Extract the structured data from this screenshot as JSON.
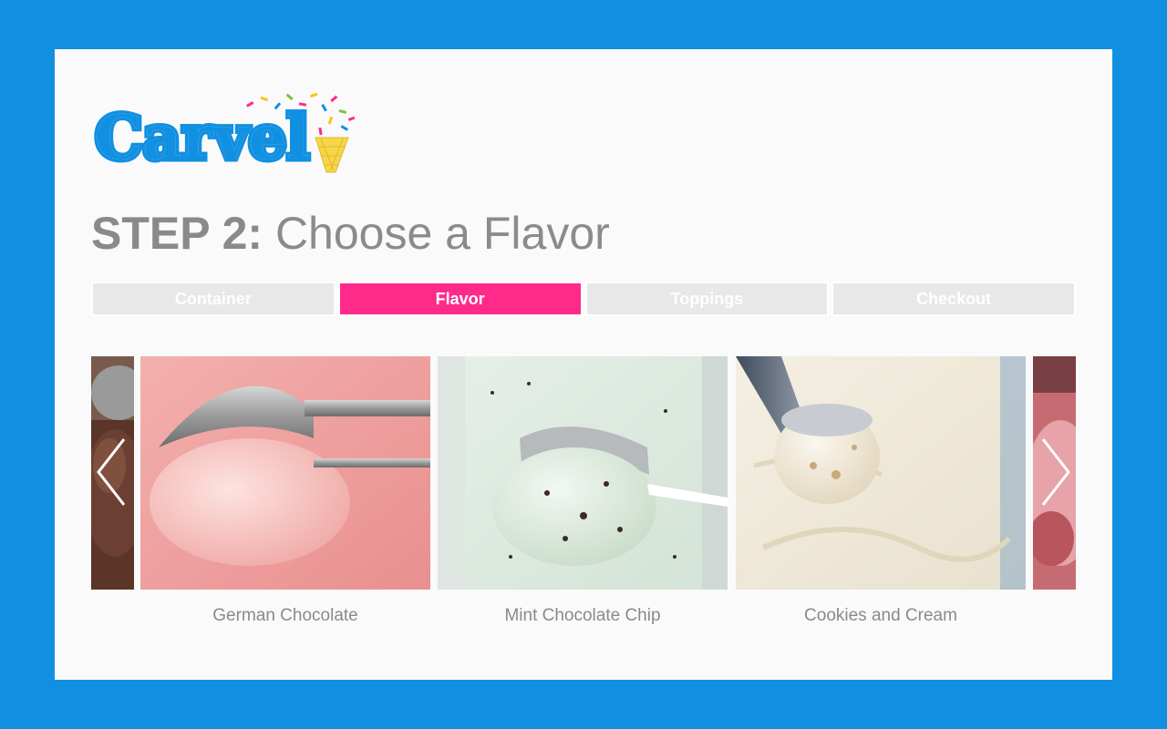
{
  "brand": {
    "name": "Carvel",
    "colors": {
      "frame": "#1190e2",
      "accent": "#ff2a8a",
      "tab_inactive": "#e8e8e8",
      "text_muted": "#8a8a8a"
    }
  },
  "header": {
    "step_label": "STEP 2:",
    "step_title": " Choose a Flavor"
  },
  "tabs": [
    {
      "label": "Container",
      "active": false
    },
    {
      "label": "Flavor",
      "active": true
    },
    {
      "label": "Toppings",
      "active": false
    },
    {
      "label": "Checkout",
      "active": false
    }
  ],
  "flavors": [
    {
      "name": "German Chocolate"
    },
    {
      "name": "Mint Chocolate Chip"
    },
    {
      "name": "Cookies and Cream"
    }
  ],
  "icons": {
    "prev": "chevron-left-icon",
    "next": "chevron-right-icon"
  }
}
